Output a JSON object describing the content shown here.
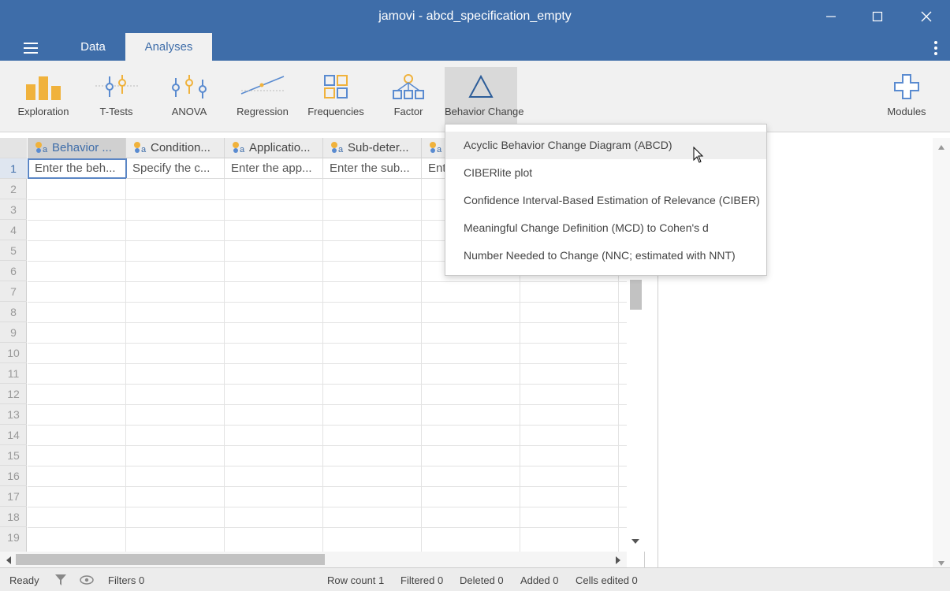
{
  "window": {
    "title": "jamovi - abcd_specification_empty"
  },
  "tabs": [
    {
      "label": "Data"
    },
    {
      "label": "Analyses"
    }
  ],
  "ribbon": {
    "items": [
      {
        "label": "Exploration",
        "icon": "exploration-icon"
      },
      {
        "label": "T-Tests",
        "icon": "t-tests-icon"
      },
      {
        "label": "ANOVA",
        "icon": "anova-icon"
      },
      {
        "label": "Regression",
        "icon": "regression-icon"
      },
      {
        "label": "Frequencies",
        "icon": "frequencies-icon"
      },
      {
        "label": "Factor",
        "icon": "factor-icon"
      },
      {
        "label": "Behavior Change",
        "icon": "behavior-change-icon"
      }
    ],
    "modules_label": "Modules"
  },
  "colors": {
    "titlebar": "#3e6da9",
    "accent": "#3e6da9",
    "ribbon_icon": "#f0b23c",
    "ribbon_icon_blue": "#5a8bd0"
  },
  "sheet": {
    "columns": [
      {
        "header": "Behavior ...",
        "row1": "Enter the beh..."
      },
      {
        "header": "Condition...",
        "row1": "Specify the c..."
      },
      {
        "header": "Applicatio...",
        "row1": "Enter the app..."
      },
      {
        "header": "Sub-deter...",
        "row1": "Enter the sub..."
      },
      {
        "header": "",
        "row1": "Ent"
      }
    ],
    "row_numbers": [
      "1",
      "2",
      "3",
      "4",
      "5",
      "6",
      "7",
      "8",
      "9",
      "10",
      "11",
      "12",
      "13",
      "14",
      "15",
      "16",
      "17",
      "18",
      "19"
    ]
  },
  "menu": {
    "items": [
      "Acyclic Behavior Change Diagram (ABCD)",
      "CIBERlite plot",
      "Confidence Interval-Based Estimation of Relevance (CIBER)",
      "Meaningful Change Definition (MCD) to Cohen's d",
      "Number Needed to Change (NNC; estimated with NNT)"
    ]
  },
  "status": {
    "ready": "Ready",
    "filters": "Filters 0",
    "row_count": "Row count 1",
    "filtered": "Filtered 0",
    "deleted": "Deleted 0",
    "added": "Added 0",
    "cells_edited": "Cells edited 0"
  }
}
